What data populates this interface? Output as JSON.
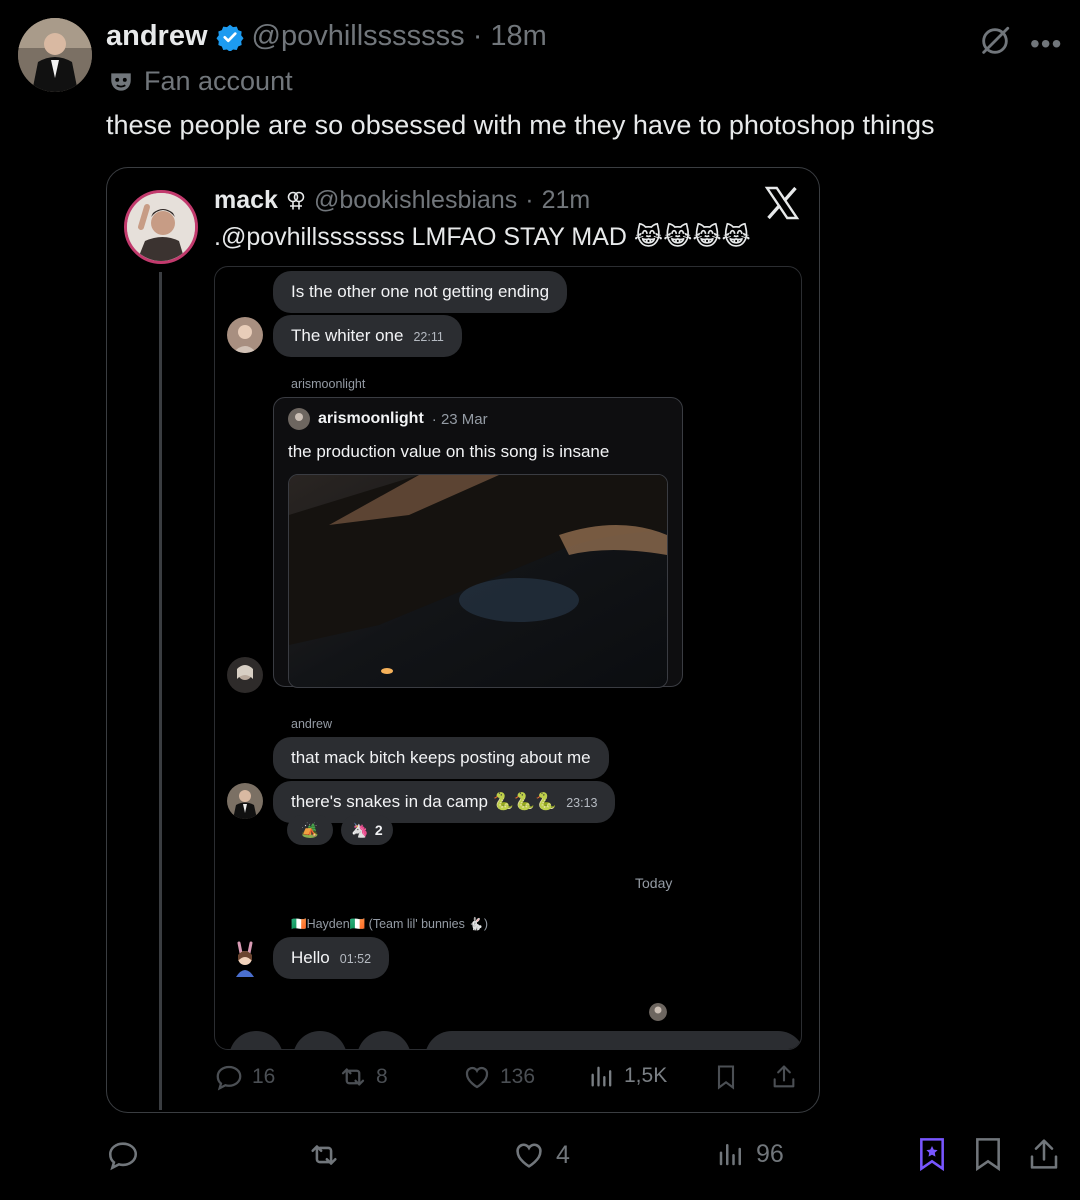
{
  "post": {
    "display_name": "andrew",
    "handle": "@povhillsssssss",
    "separator": "·",
    "time": "18m",
    "label": "Fan account",
    "text": "these people are so obsessed with me they have to photoshop things"
  },
  "embedded_post": {
    "display_name": "mack",
    "handle": "@bookishlesbians",
    "separator": "·",
    "time": "21m",
    "text": ".@povhillsssssss LMFAO STAY MAD 😹😹😹😹",
    "chat": {
      "msg1": "Is the other one not getting ending",
      "msg2": "The whiter one",
      "msg2_time": "22:11",
      "sender_aris": "arismoonlight",
      "quote_name": "arismoonlight",
      "quote_date": "· 23 Mar",
      "quote_text": "the production value on this song is insane",
      "sender_andrew": "andrew",
      "msg3": "that mack bitch keeps posting about me",
      "msg4": "there's snakes in da camp 🐍🐍🐍",
      "msg4_time": "23:13",
      "reaction1": "🏕️",
      "reaction2_emoji": "🦄",
      "reaction2_count": "2",
      "divider": "Today",
      "sender_hayden": "🇮🇪Hayden🇮🇪 (Team lil' bunnies 🐇)",
      "msg5": "Hello",
      "msg5_time": "01:52"
    },
    "actions": {
      "replies": "16",
      "reposts": "8",
      "likes": "136",
      "views": "1,5K"
    }
  },
  "actions": {
    "replies": "",
    "reposts": "",
    "likes": "4",
    "views": "96"
  },
  "colors": {
    "background": "#000000",
    "text_primary": "#e7e9ea",
    "text_secondary": "#71767b",
    "verified": "#1d9bf0",
    "bookmark_grok": "#7856ff",
    "chat_bubble": "#2b2d31"
  }
}
